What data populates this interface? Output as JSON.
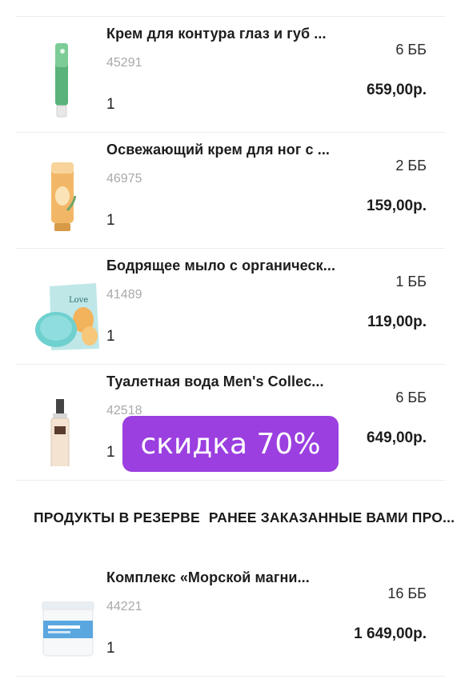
{
  "items": [
    {
      "name": "Крем для контура глаз и губ ...",
      "code": "45291",
      "qty": "1",
      "points": "6 ББ",
      "price": "659,00р."
    },
    {
      "name": "Освежающий крем для ног с ...",
      "code": "46975",
      "qty": "1",
      "points": "2 ББ",
      "price": "159,00р."
    },
    {
      "name": "Бодрящее мыло с органическ...",
      "code": "41489",
      "qty": "1",
      "points": "1 ББ",
      "price": "119,00р."
    },
    {
      "name": "Туалетная вода Men's Collec...",
      "code": "42518",
      "qty": "1",
      "points": "6 ББ",
      "price": "649,00р."
    }
  ],
  "promo_badge": "скидка 70%",
  "reserve_section": {
    "tab_reserved": "ПРОДУКТЫ В РЕЗЕРВЕ",
    "tab_previous": "РАНЕЕ ЗАКАЗАННЫЕ ВАМИ ПРО..."
  },
  "reserve_items": [
    {
      "name": "Комплекс «Морской магни...",
      "code": "44221",
      "qty": "1",
      "points": "16 ББ",
      "price": "1 649,00р."
    }
  ],
  "colors": {
    "accent": "#9b3fe0",
    "separator": "#ececec",
    "muted": "#a9a9a9"
  },
  "icons": {
    "eye_cream": "green-tube-image",
    "foot_cream": "orange-tube-image",
    "soap": "soap-pack-image",
    "perfume": "perfume-bottle-image",
    "magnesium": "supplement-jar-image"
  }
}
